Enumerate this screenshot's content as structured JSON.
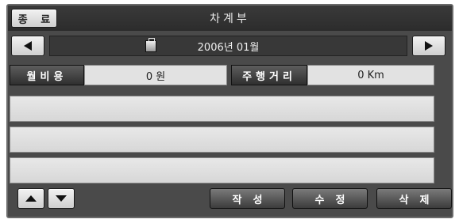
{
  "header": {
    "exit_label": "종 료",
    "title": "차계부"
  },
  "nav": {
    "month_label": "2006년 01월",
    "prev_icon": "left-arrow-icon",
    "next_icon": "right-arrow-icon",
    "calendar_icon": "calendar-icon"
  },
  "summary": {
    "monthly_cost_label": "월비용",
    "monthly_cost_value": "0 원",
    "distance_label": "주행거리",
    "distance_value": "0 Km"
  },
  "list": {
    "rows": [
      "",
      "",
      ""
    ]
  },
  "footer": {
    "up_icon": "up-arrow-icon",
    "down_icon": "down-arrow-icon",
    "write_label": "작성",
    "edit_label": "수정",
    "delete_label": "삭제"
  }
}
